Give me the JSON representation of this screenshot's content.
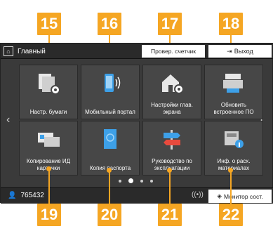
{
  "callouts": {
    "c15": "15",
    "c16": "16",
    "c17": "17",
    "c18": "18",
    "c19": "19",
    "c20": "20",
    "c21": "21",
    "c22": "22"
  },
  "topbar": {
    "home_label": "Главный",
    "check_counter": "Провер. счетчик",
    "logout": "Выход"
  },
  "tiles": [
    {
      "label": "Настр. бумаги",
      "icon": "paper-settings-icon"
    },
    {
      "label": "Мобильный портал",
      "icon": "mobile-portal-icon"
    },
    {
      "label": "Настройки глав. экрана",
      "icon": "home-settings-icon"
    },
    {
      "label": "Обновить встроенное ПО",
      "icon": "firmware-update-icon"
    },
    {
      "label": "Копирование ИД карточки",
      "icon": "id-card-copy-icon"
    },
    {
      "label": "Копия паспорта",
      "icon": "passport-copy-icon"
    },
    {
      "label": "Руководство по эксплуатации",
      "icon": "manual-icon"
    },
    {
      "label": "Инф. о расх. материалах",
      "icon": "consumables-icon"
    }
  ],
  "bottombar": {
    "user_id": "765432",
    "monitor": "Монитор сост."
  },
  "pagination": {
    "pages": 4,
    "active": 2
  }
}
